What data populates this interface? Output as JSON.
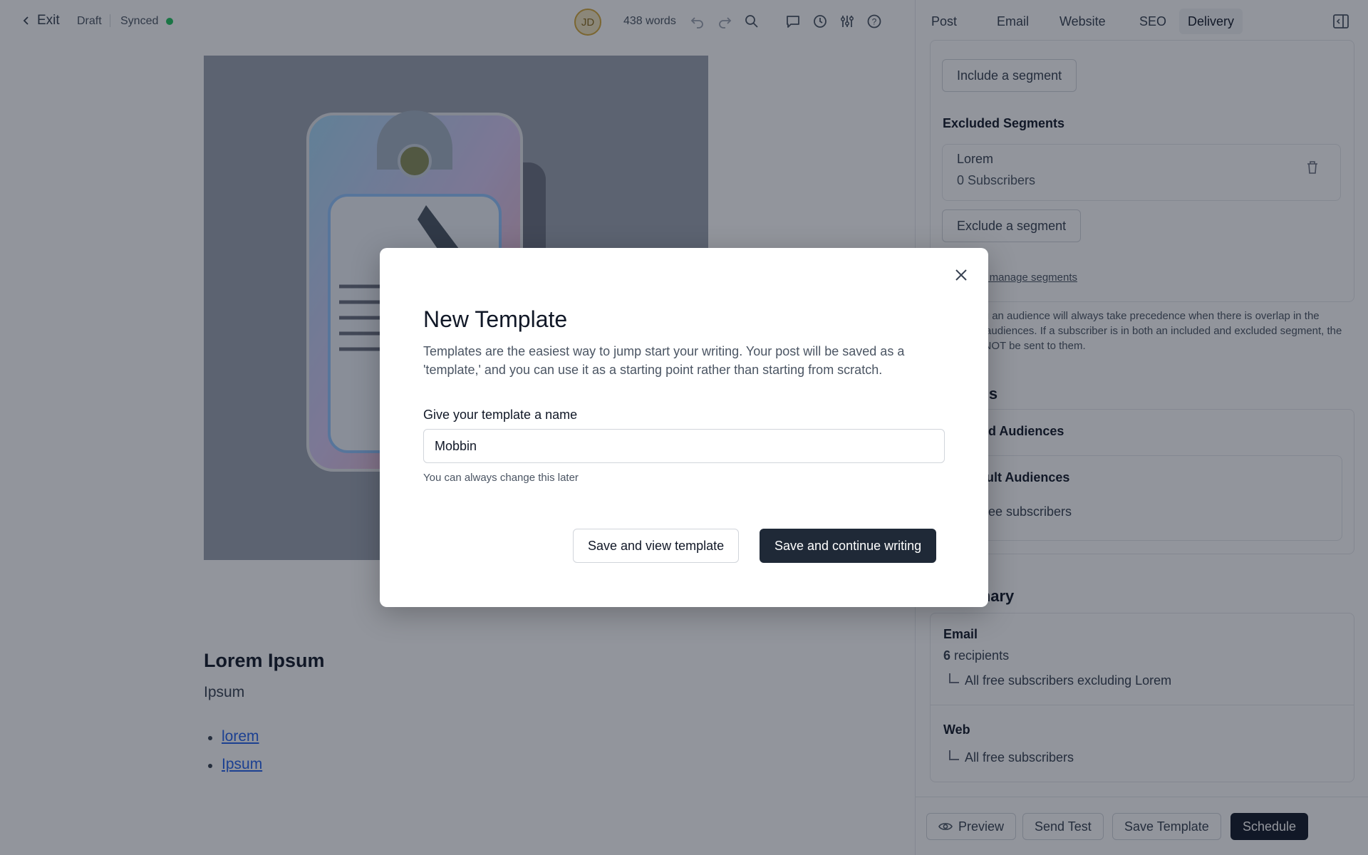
{
  "topbar": {
    "exit_label": "Exit",
    "status": "Draft",
    "sync_status": "Synced",
    "avatar_initials": "JD",
    "word_count": "438 words"
  },
  "panel": {
    "tabs": [
      "Post",
      "Email",
      "Website",
      "SEO",
      "Delivery"
    ],
    "active_tab": "Delivery",
    "include_segment_label": "Include a segment",
    "excluded_segments_title": "Excluded Segments",
    "excluded_segment": {
      "name": "Lorem",
      "subscribers": "0 Subscribers"
    },
    "exclude_segment_label": "Exclude a segment",
    "manage_segments_link": "View and manage segments",
    "precedence_note": "Excluding an audience will always take precedence when there is overlap in the selected audiences. If a subscriber is in both an included and excluded segment, the post will NOT be sent to them.",
    "access_title": "Access",
    "selected_audiences_title": "Selected Audiences",
    "default_audiences_title": "Default Audiences",
    "default_audience_item": "All Free subscribers",
    "summary_title": "Summary",
    "email_title": "Email",
    "email_count": "6",
    "email_recipients_label": "recipients",
    "email_detail": "All free subscribers excluding Lorem",
    "web_title": "Web",
    "web_detail": "All free subscribers"
  },
  "editor": {
    "post_title": "Lorem Ipsum",
    "post_subtitle": "Ipsum",
    "links": [
      "lorem",
      "Ipsum"
    ]
  },
  "footer": {
    "preview": "Preview",
    "send_test": "Send Test",
    "save_template": "Save Template",
    "schedule": "Schedule"
  },
  "modal": {
    "title": "New Template",
    "description": "Templates are the easiest way to jump start your writing. Your post will be saved as a 'template,' and you can use it as a starting point rather than starting from scratch.",
    "field_label": "Give your template a name",
    "field_value": "Mobbin",
    "hint": "You can always change this later",
    "secondary_button": "Save and view template",
    "primary_button": "Save and continue writing"
  },
  "colors": {
    "sync_dot": "#22c55e",
    "primary_button": "#1f2937",
    "link": "#2563eb",
    "overlay": "rgba(17,24,39,0.46)"
  }
}
